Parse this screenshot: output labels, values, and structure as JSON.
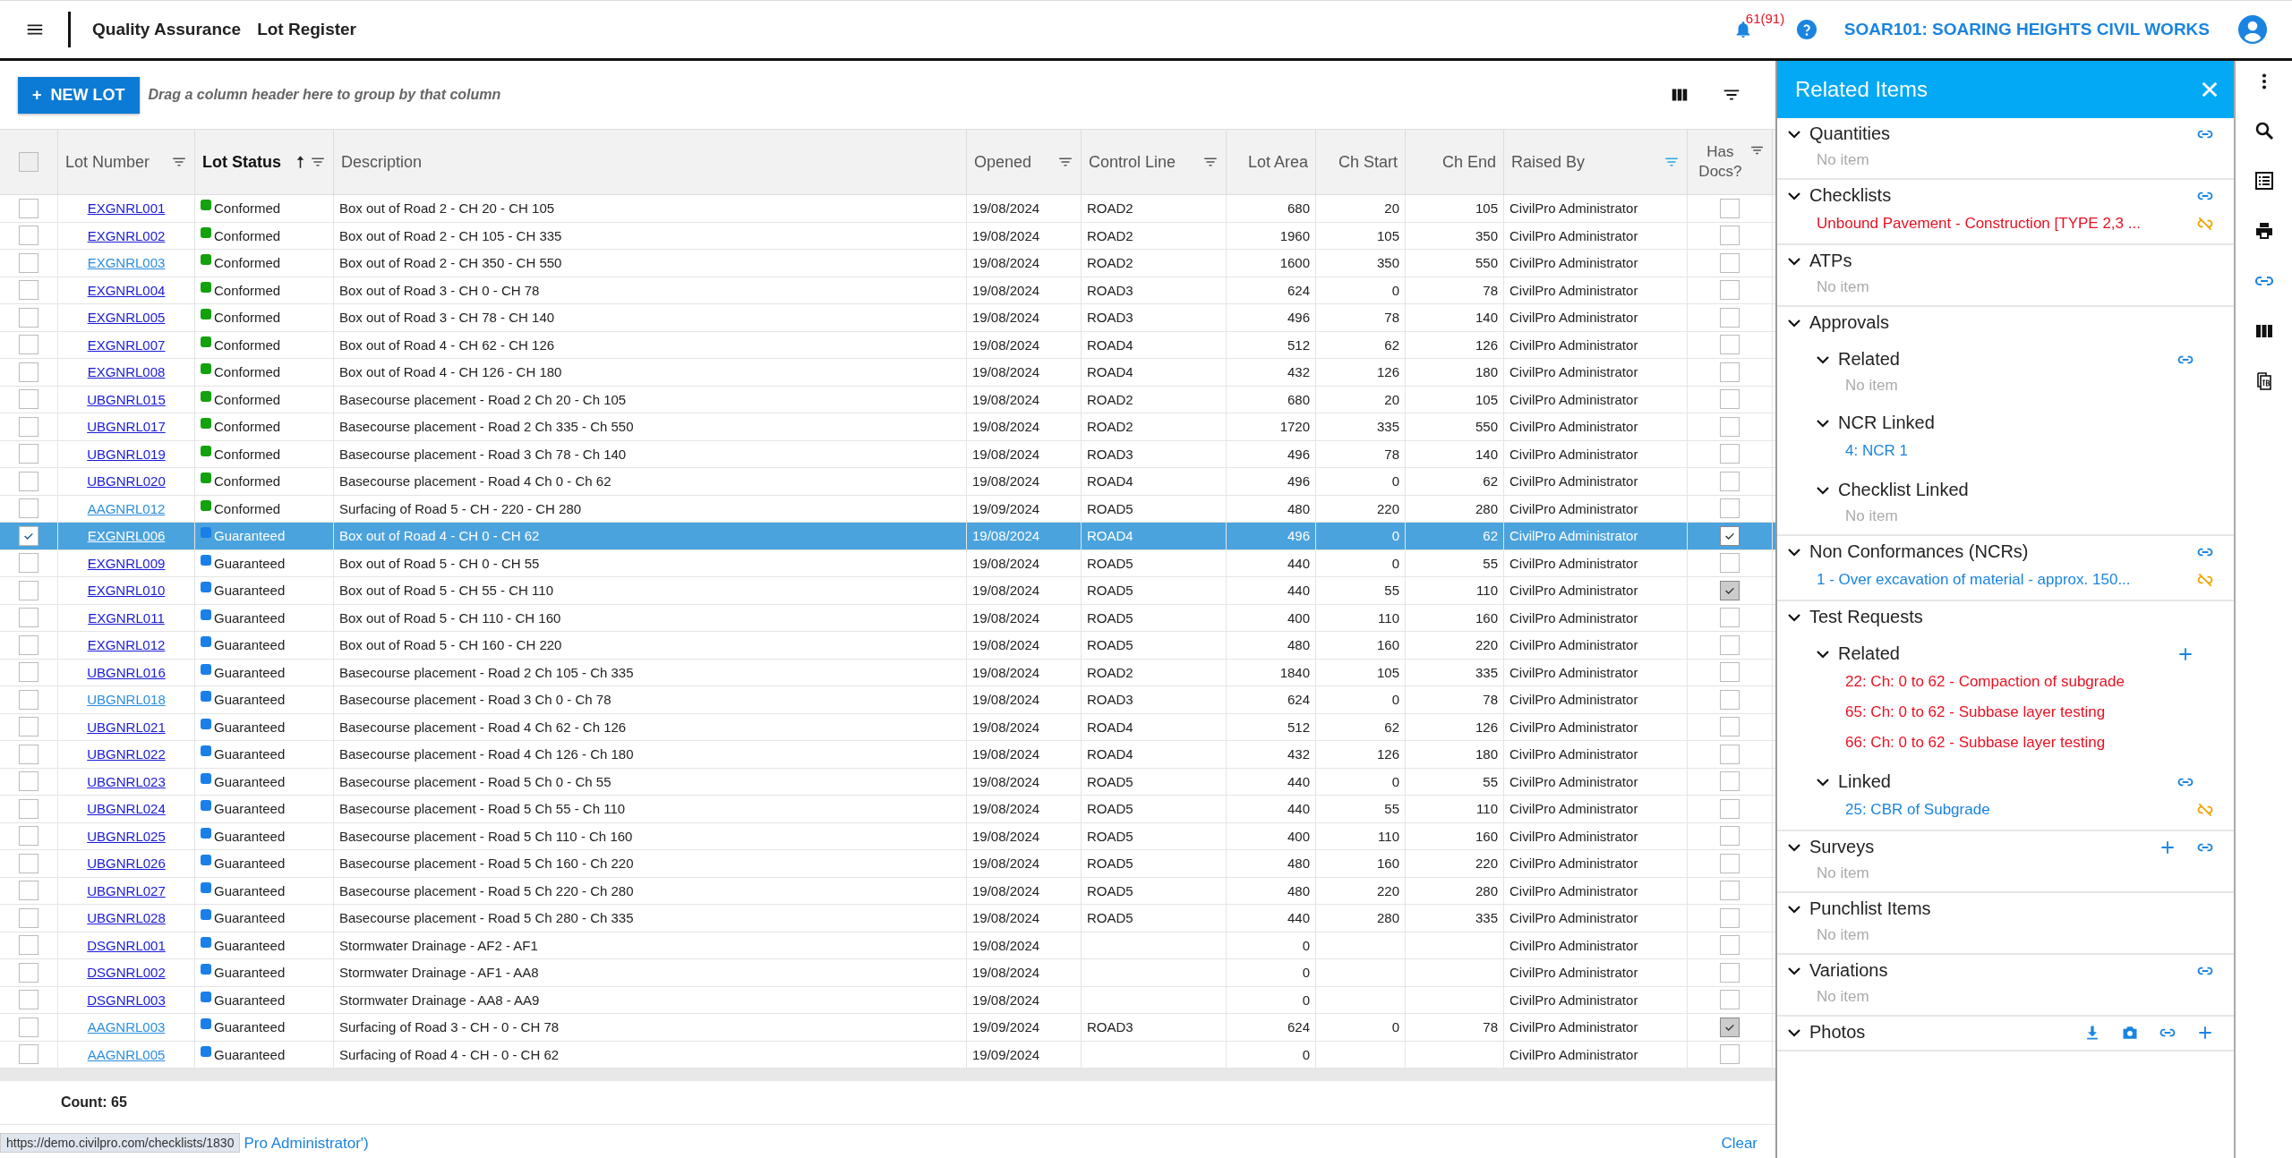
{
  "header": {
    "breadcrumb": [
      "Quality Assurance",
      "Lot Register"
    ],
    "notification_count": "61(91)",
    "project": "SOAR101: SOARING HEIGHTS CIVIL WORKS"
  },
  "toolbar": {
    "new_button": "NEW LOT",
    "new_icon": "+",
    "group_hint": "Drag a column header here to group by that column"
  },
  "table": {
    "columns": [
      {
        "label": "Lot Number",
        "filter": true,
        "filtered": false,
        "sorted": false
      },
      {
        "label": "Lot Status",
        "filter": true,
        "filtered": false,
        "sorted": true
      },
      {
        "label": "Description",
        "filter": false,
        "sorted": false
      },
      {
        "label": "Opened",
        "filter": true,
        "filtered": false,
        "sorted": false
      },
      {
        "label": "Control Line",
        "filter": true,
        "filtered": false,
        "sorted": false
      },
      {
        "label": "Lot Area",
        "filter": false,
        "sorted": false
      },
      {
        "label": "Ch Start",
        "filter": false,
        "sorted": false
      },
      {
        "label": "Ch End",
        "filter": false,
        "sorted": false
      },
      {
        "label": "Raised By",
        "filter": true,
        "filtered": true,
        "sorted": false
      },
      {
        "label": "Has Docs?",
        "filter": true,
        "filtered": false,
        "sorted": false
      }
    ],
    "select_all": false,
    "rows": [
      {
        "lot": "EXGNRL001",
        "visited": false,
        "status": "Conformed",
        "color": "#13a10e",
        "desc": "Box out of Road 2 - CH 20 - CH 105",
        "opened": "19/08/2024",
        "line": "ROAD2",
        "area": "680",
        "start": "20",
        "end": "105",
        "raised": "CivilPro Administrator",
        "docs": false,
        "selected": false
      },
      {
        "lot": "EXGNRL002",
        "visited": false,
        "status": "Conformed",
        "color": "#13a10e",
        "desc": "Box out of Road 2 - CH 105 - CH 335",
        "opened": "19/08/2024",
        "line": "ROAD2",
        "area": "1960",
        "start": "105",
        "end": "350",
        "raised": "CivilPro Administrator",
        "docs": false,
        "selected": false
      },
      {
        "lot": "EXGNRL003",
        "visited": true,
        "status": "Conformed",
        "color": "#13a10e",
        "desc": "Box out of Road 2 - CH 350 - CH 550",
        "opened": "19/08/2024",
        "line": "ROAD2",
        "area": "1600",
        "start": "350",
        "end": "550",
        "raised": "CivilPro Administrator",
        "docs": false,
        "selected": false
      },
      {
        "lot": "EXGNRL004",
        "visited": false,
        "status": "Conformed",
        "color": "#13a10e",
        "desc": "Box out of Road 3 - CH 0 - CH 78",
        "opened": "19/08/2024",
        "line": "ROAD3",
        "area": "624",
        "start": "0",
        "end": "78",
        "raised": "CivilPro Administrator",
        "docs": false,
        "selected": false
      },
      {
        "lot": "EXGNRL005",
        "visited": false,
        "status": "Conformed",
        "color": "#13a10e",
        "desc": "Box out of Road 3 - CH 78 - CH 140",
        "opened": "19/08/2024",
        "line": "ROAD3",
        "area": "496",
        "start": "78",
        "end": "140",
        "raised": "CivilPro Administrator",
        "docs": false,
        "selected": false
      },
      {
        "lot": "EXGNRL007",
        "visited": false,
        "status": "Conformed",
        "color": "#13a10e",
        "desc": "Box out of Road 4 - CH 62 - CH 126",
        "opened": "19/08/2024",
        "line": "ROAD4",
        "area": "512",
        "start": "62",
        "end": "126",
        "raised": "CivilPro Administrator",
        "docs": false,
        "selected": false
      },
      {
        "lot": "EXGNRL008",
        "visited": false,
        "status": "Conformed",
        "color": "#13a10e",
        "desc": "Box out of Road 4 - CH 126 - CH 180",
        "opened": "19/08/2024",
        "line": "ROAD4",
        "area": "432",
        "start": "126",
        "end": "180",
        "raised": "CivilPro Administrator",
        "docs": false,
        "selected": false
      },
      {
        "lot": "UBGNRL015",
        "visited": false,
        "status": "Conformed",
        "color": "#13a10e",
        "desc": "Basecourse placement - Road 2 Ch 20 - Ch 105",
        "opened": "19/08/2024",
        "line": "ROAD2",
        "area": "680",
        "start": "20",
        "end": "105",
        "raised": "CivilPro Administrator",
        "docs": false,
        "selected": false
      },
      {
        "lot": "UBGNRL017",
        "visited": false,
        "status": "Conformed",
        "color": "#13a10e",
        "desc": "Basecourse placement - Road 2 Ch 335 - Ch 550",
        "opened": "19/08/2024",
        "line": "ROAD2",
        "area": "1720",
        "start": "335",
        "end": "550",
        "raised": "CivilPro Administrator",
        "docs": false,
        "selected": false
      },
      {
        "lot": "UBGNRL019",
        "visited": false,
        "status": "Conformed",
        "color": "#13a10e",
        "desc": "Basecourse placement - Road 3 Ch 78 - Ch 140",
        "opened": "19/08/2024",
        "line": "ROAD3",
        "area": "496",
        "start": "78",
        "end": "140",
        "raised": "CivilPro Administrator",
        "docs": false,
        "selected": false
      },
      {
        "lot": "UBGNRL020",
        "visited": false,
        "status": "Conformed",
        "color": "#13a10e",
        "desc": "Basecourse placement - Road 4 Ch 0 - Ch 62",
        "opened": "19/08/2024",
        "line": "ROAD4",
        "area": "496",
        "start": "0",
        "end": "62",
        "raised": "CivilPro Administrator",
        "docs": false,
        "selected": false
      },
      {
        "lot": "AAGNRL012",
        "visited": true,
        "status": "Conformed",
        "color": "#13a10e",
        "desc": "Surfacing of Road 5 - CH - 220 - CH 280",
        "opened": "19/09/2024",
        "line": "ROAD5",
        "area": "480",
        "start": "220",
        "end": "280",
        "raised": "CivilPro Administrator",
        "docs": false,
        "selected": false
      },
      {
        "lot": "EXGNRL006",
        "visited": false,
        "status": "Guaranteed",
        "color": "#1a7fe8",
        "desc": "Box out of Road 4 - CH 0 - CH 62",
        "opened": "19/08/2024",
        "line": "ROAD4",
        "area": "496",
        "start": "0",
        "end": "62",
        "raised": "CivilPro Administrator",
        "docs": true,
        "selected": true
      },
      {
        "lot": "EXGNRL009",
        "visited": false,
        "status": "Guaranteed",
        "color": "#1a7fe8",
        "desc": "Box out of Road 5 - CH 0 - CH 55",
        "opened": "19/08/2024",
        "line": "ROAD5",
        "area": "440",
        "start": "0",
        "end": "55",
        "raised": "CivilPro Administrator",
        "docs": false,
        "selected": false
      },
      {
        "lot": "EXGNRL010",
        "visited": false,
        "status": "Guaranteed",
        "color": "#1a7fe8",
        "desc": "Box out of Road 5 - CH 55 - CH 110",
        "opened": "19/08/2024",
        "line": "ROAD5",
        "area": "440",
        "start": "55",
        "end": "110",
        "raised": "CivilPro Administrator",
        "docs": true,
        "selected": false
      },
      {
        "lot": "EXGNRL011",
        "visited": false,
        "status": "Guaranteed",
        "color": "#1a7fe8",
        "desc": "Box out of Road 5 - CH 110 - CH 160",
        "opened": "19/08/2024",
        "line": "ROAD5",
        "area": "400",
        "start": "110",
        "end": "160",
        "raised": "CivilPro Administrator",
        "docs": false,
        "selected": false
      },
      {
        "lot": "EXGNRL012",
        "visited": false,
        "status": "Guaranteed",
        "color": "#1a7fe8",
        "desc": "Box out of Road 5 - CH 160 - CH 220",
        "opened": "19/08/2024",
        "line": "ROAD5",
        "area": "480",
        "start": "160",
        "end": "220",
        "raised": "CivilPro Administrator",
        "docs": false,
        "selected": false
      },
      {
        "lot": "UBGNRL016",
        "visited": false,
        "status": "Guaranteed",
        "color": "#1a7fe8",
        "desc": "Basecourse placement - Road 2 Ch 105 - Ch 335",
        "opened": "19/08/2024",
        "line": "ROAD2",
        "area": "1840",
        "start": "105",
        "end": "335",
        "raised": "CivilPro Administrator",
        "docs": false,
        "selected": false
      },
      {
        "lot": "UBGNRL018",
        "visited": true,
        "status": "Guaranteed",
        "color": "#1a7fe8",
        "desc": "Basecourse placement - Road 3 Ch 0 - Ch 78",
        "opened": "19/08/2024",
        "line": "ROAD3",
        "area": "624",
        "start": "0",
        "end": "78",
        "raised": "CivilPro Administrator",
        "docs": false,
        "selected": false
      },
      {
        "lot": "UBGNRL021",
        "visited": false,
        "status": "Guaranteed",
        "color": "#1a7fe8",
        "desc": "Basecourse placement - Road 4 Ch 62 - Ch 126",
        "opened": "19/08/2024",
        "line": "ROAD4",
        "area": "512",
        "start": "62",
        "end": "126",
        "raised": "CivilPro Administrator",
        "docs": false,
        "selected": false
      },
      {
        "lot": "UBGNRL022",
        "visited": false,
        "status": "Guaranteed",
        "color": "#1a7fe8",
        "desc": "Basecourse placement - Road 4 Ch 126 - Ch 180",
        "opened": "19/08/2024",
        "line": "ROAD4",
        "area": "432",
        "start": "126",
        "end": "180",
        "raised": "CivilPro Administrator",
        "docs": false,
        "selected": false
      },
      {
        "lot": "UBGNRL023",
        "visited": false,
        "status": "Guaranteed",
        "color": "#1a7fe8",
        "desc": "Basecourse placement - Road 5 Ch 0 - Ch 55",
        "opened": "19/08/2024",
        "line": "ROAD5",
        "area": "440",
        "start": "0",
        "end": "55",
        "raised": "CivilPro Administrator",
        "docs": false,
        "selected": false
      },
      {
        "lot": "UBGNRL024",
        "visited": false,
        "status": "Guaranteed",
        "color": "#1a7fe8",
        "desc": "Basecourse placement - Road 5 Ch 55 - Ch 110",
        "opened": "19/08/2024",
        "line": "ROAD5",
        "area": "440",
        "start": "55",
        "end": "110",
        "raised": "CivilPro Administrator",
        "docs": false,
        "selected": false
      },
      {
        "lot": "UBGNRL025",
        "visited": false,
        "status": "Guaranteed",
        "color": "#1a7fe8",
        "desc": "Basecourse placement - Road 5 Ch 110 - Ch 160",
        "opened": "19/08/2024",
        "line": "ROAD5",
        "area": "400",
        "start": "110",
        "end": "160",
        "raised": "CivilPro Administrator",
        "docs": false,
        "selected": false
      },
      {
        "lot": "UBGNRL026",
        "visited": false,
        "status": "Guaranteed",
        "color": "#1a7fe8",
        "desc": "Basecourse placement - Road 5 Ch 160 - Ch 220",
        "opened": "19/08/2024",
        "line": "ROAD5",
        "area": "480",
        "start": "160",
        "end": "220",
        "raised": "CivilPro Administrator",
        "docs": false,
        "selected": false
      },
      {
        "lot": "UBGNRL027",
        "visited": false,
        "status": "Guaranteed",
        "color": "#1a7fe8",
        "desc": "Basecourse placement - Road 5 Ch 220 - Ch 280",
        "opened": "19/08/2024",
        "line": "ROAD5",
        "area": "480",
        "start": "220",
        "end": "280",
        "raised": "CivilPro Administrator",
        "docs": false,
        "selected": false
      },
      {
        "lot": "UBGNRL028",
        "visited": false,
        "status": "Guaranteed",
        "color": "#1a7fe8",
        "desc": "Basecourse placement - Road 5 Ch 280 - Ch 335",
        "opened": "19/08/2024",
        "line": "ROAD5",
        "area": "440",
        "start": "280",
        "end": "335",
        "raised": "CivilPro Administrator",
        "docs": false,
        "selected": false
      },
      {
        "lot": "DSGNRL001",
        "visited": false,
        "status": "Guaranteed",
        "color": "#1a7fe8",
        "desc": "Stormwater Drainage - AF2 - AF1",
        "opened": "19/08/2024",
        "area": "0",
        "raised": "CivilPro Administrator",
        "docs": false,
        "selected": false
      },
      {
        "lot": "DSGNRL002",
        "visited": false,
        "status": "Guaranteed",
        "color": "#1a7fe8",
        "desc": "Stormwater Drainage - AF1 - AA8",
        "opened": "19/08/2024",
        "area": "0",
        "raised": "CivilPro Administrator",
        "docs": false,
        "selected": false
      },
      {
        "lot": "DSGNRL003",
        "visited": false,
        "status": "Guaranteed",
        "color": "#1a7fe8",
        "desc": "Stormwater Drainage - AA8 - AA9",
        "opened": "19/08/2024",
        "area": "0",
        "raised": "CivilPro Administrator",
        "docs": false,
        "selected": false
      },
      {
        "lot": "AAGNRL003",
        "visited": true,
        "status": "Guaranteed",
        "color": "#1a7fe8",
        "desc": "Surfacing of Road 3 - CH - 0 - CH 78",
        "opened": "19/09/2024",
        "line": "ROAD3",
        "area": "624",
        "start": "0",
        "end": "78",
        "raised": "CivilPro Administrator",
        "docs": true,
        "selected": false
      },
      {
        "lot": "AAGNRL005",
        "visited": true,
        "status": "Guaranteed",
        "color": "#1a7fe8",
        "desc": "Surfacing of Road 4 - CH - 0 - CH 62",
        "opened": "19/09/2024",
        "area": "0",
        "raised": "CivilPro Administrator",
        "docs": false,
        "selected": false
      }
    ],
    "count": "Count: 65",
    "filter_text": "Pro Administrator')",
    "clear": "Clear",
    "status_url": "https://demo.civilpro.com/checklists/1830"
  },
  "panel": {
    "title": "Related Items",
    "sections": [
      {
        "title": "Quantities",
        "actions": [
          {
            "kind": "link"
          }
        ],
        "empty": "No item"
      },
      {
        "title": "Checklists",
        "actions": [
          {
            "kind": "link"
          }
        ],
        "items": [
          {
            "text": "Unbound Pavement - Construction [TYPE 2,3 ...",
            "color": "#e81123",
            "unlink": true
          }
        ]
      },
      {
        "title": "ATPs",
        "empty": "No item"
      },
      {
        "title": "Approvals",
        "children": [
          {
            "title": "Related",
            "actions": [
              {
                "kind": "link"
              }
            ],
            "empty": "No item"
          },
          {
            "title": "NCR Linked",
            "items": [
              {
                "text": "4: NCR 1",
                "color": "#1a84e0",
                "unlink": false
              }
            ]
          },
          {
            "title": "Checklist Linked",
            "empty": "No item"
          }
        ]
      },
      {
        "title": "Non Conformances (NCRs)",
        "actions": [
          {
            "kind": "link"
          }
        ],
        "items": [
          {
            "text": "1 - Over excavation of material - approx. 150...",
            "color": "#1a84e0",
            "unlink": true
          }
        ]
      },
      {
        "title": "Test Requests",
        "children": [
          {
            "title": "Related",
            "actions": [
              {
                "kind": "add"
              }
            ],
            "items": [
              {
                "text": "22: Ch: 0 to 62 - Compaction of subgrade",
                "color": "#e81123",
                "unlink": false
              },
              {
                "text": "65: Ch: 0 to 62 - Subbase layer testing",
                "color": "#e81123",
                "unlink": false
              },
              {
                "text": "66: Ch: 0 to 62 - Subbase layer testing",
                "color": "#e81123",
                "unlink": false
              }
            ]
          },
          {
            "title": "Linked",
            "actions": [
              {
                "kind": "link"
              }
            ],
            "items": [
              {
                "text": "25: CBR of Subgrade",
                "color": "#1a84e0",
                "unlink": true
              }
            ]
          }
        ]
      },
      {
        "title": "Surveys",
        "actions": [
          {
            "kind": "add"
          },
          {
            "kind": "link"
          }
        ],
        "empty": "No item"
      },
      {
        "title": "Punchlist Items",
        "empty": "No item"
      },
      {
        "title": "Variations",
        "actions": [
          {
            "kind": "link"
          }
        ],
        "empty": "No item"
      },
      {
        "title": "Photos",
        "actions": [
          {
            "kind": "download"
          },
          {
            "kind": "camera"
          },
          {
            "kind": "link"
          },
          {
            "kind": "add"
          }
        ]
      }
    ]
  }
}
